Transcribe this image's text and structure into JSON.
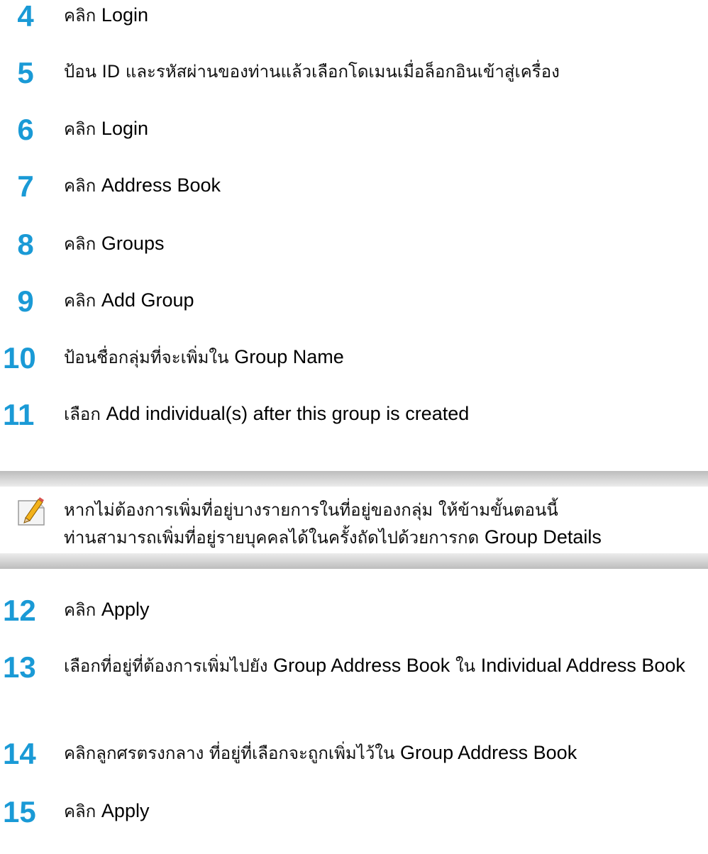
{
  "steps_a": [
    {
      "num": "4",
      "pre": "คลิก ",
      "hl": "Login",
      "post": ""
    },
    {
      "num": "5",
      "pre": "ป้อน ID และรหัสผ่านของท่านแล้วเลือกโดเมนเมื่อล็อกอินเข้าสู่เครื่อง",
      "hl": "",
      "post": ""
    },
    {
      "num": "6",
      "pre": "คลิก ",
      "hl": "Login",
      "post": ""
    },
    {
      "num": "7",
      "pre": "คลิก ",
      "hl": "Address Book",
      "post": ""
    },
    {
      "num": "8",
      "pre": "คลิก ",
      "hl": "Groups",
      "post": ""
    },
    {
      "num": "9",
      "pre": "คลิก ",
      "hl": "Add Group",
      "post": ""
    },
    {
      "num": "10",
      "pre": "ป้อนชื่อกลุ่มที่จะเพิ่มใน ",
      "hl": "Group Name",
      "post": ""
    },
    {
      "num": "11",
      "pre": "เลือก ",
      "hl": "Add individual(s) after this group is created",
      "post": ""
    }
  ],
  "note": {
    "icon": "note-pencil-icon",
    "line1": "หากไม่ต้องการเพิ่มที่อยู่บางรายการในที่อยู่ของกลุ่ม ให้ข้ามขั้นตอนนี้",
    "line2_pre": "ท่านสามารถเพิ่มที่อยู่รายบุคคลได้ในครั้งถัดไปด้วยการกด ",
    "line2_hl": "Group Details"
  },
  "steps_b": [
    {
      "num": "12",
      "pre": "คลิก ",
      "hl": "Apply"
    },
    {
      "num": "13",
      "pre": "เลือกที่อยู่ที่ต้องการเพิ่มไปยัง ",
      "hl": "Group Address Book",
      "mid": " ใน ",
      "hl2": "Individual Address Book"
    },
    {
      "num": "14",
      "pre": "คลิกลูกศรตรงกลาง ที่อยู่ที่เลือกจะถูกเพิ่มไว้ใน ",
      "hl": "Group Address Book"
    },
    {
      "num": "15",
      "pre": "คลิก ",
      "hl": "Apply"
    }
  ],
  "colors": {
    "step_number": "#1a9ad6",
    "note_bar": "#c9c9c9"
  }
}
